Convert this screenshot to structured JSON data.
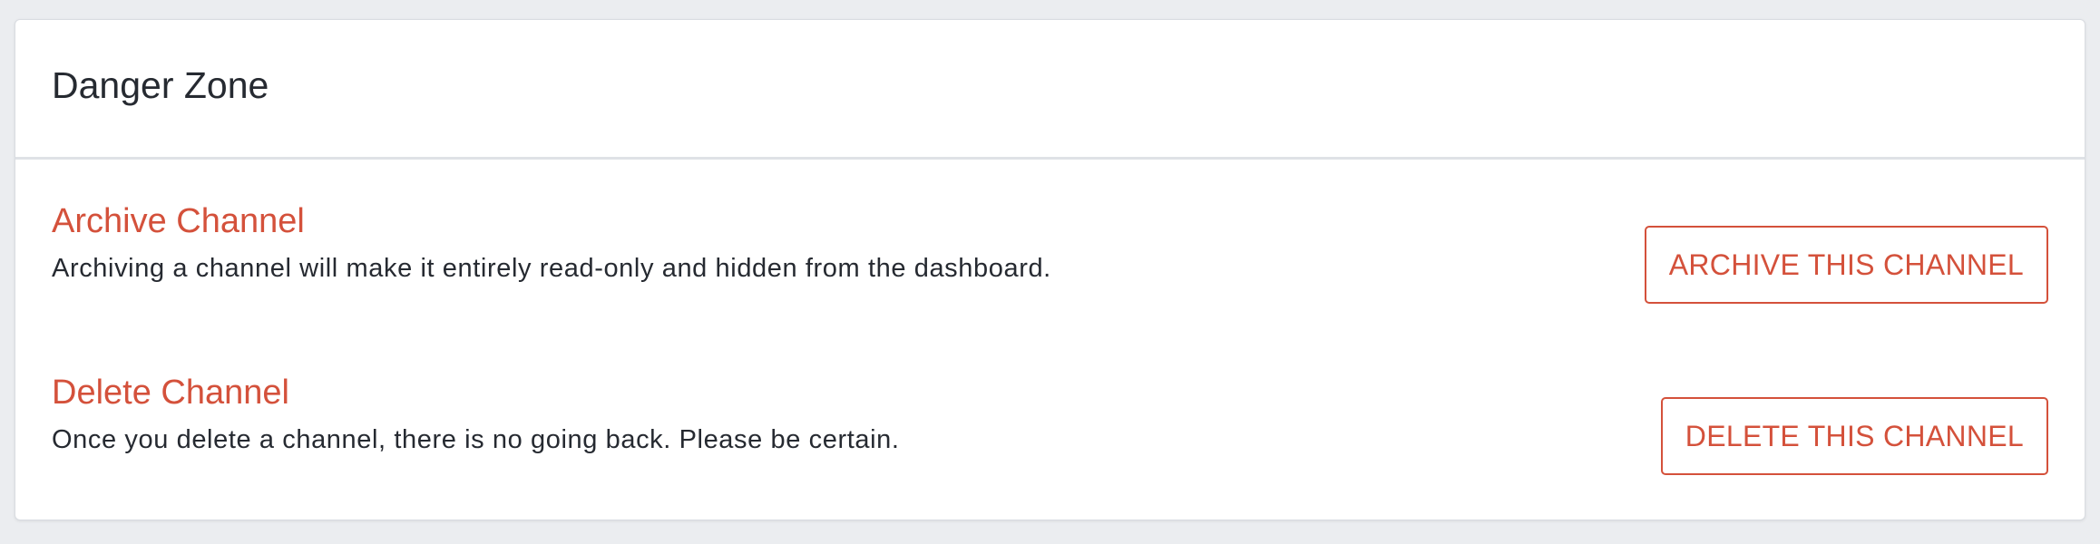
{
  "card": {
    "title": "Danger Zone"
  },
  "actions": [
    {
      "title": "Archive Channel",
      "description": "Archiving a channel will make it entirely read-only and hidden from the dashboard.",
      "button_label": "ARCHIVE THIS CHANNEL"
    },
    {
      "title": "Delete Channel",
      "description": "Once you delete a channel, there is no going back. Please be certain.",
      "button_label": "DELETE THIS CHANNEL"
    }
  ],
  "colors": {
    "danger": "#d4513b",
    "text": "#262a31",
    "background": "#ebedf0",
    "card": "#ffffff"
  }
}
